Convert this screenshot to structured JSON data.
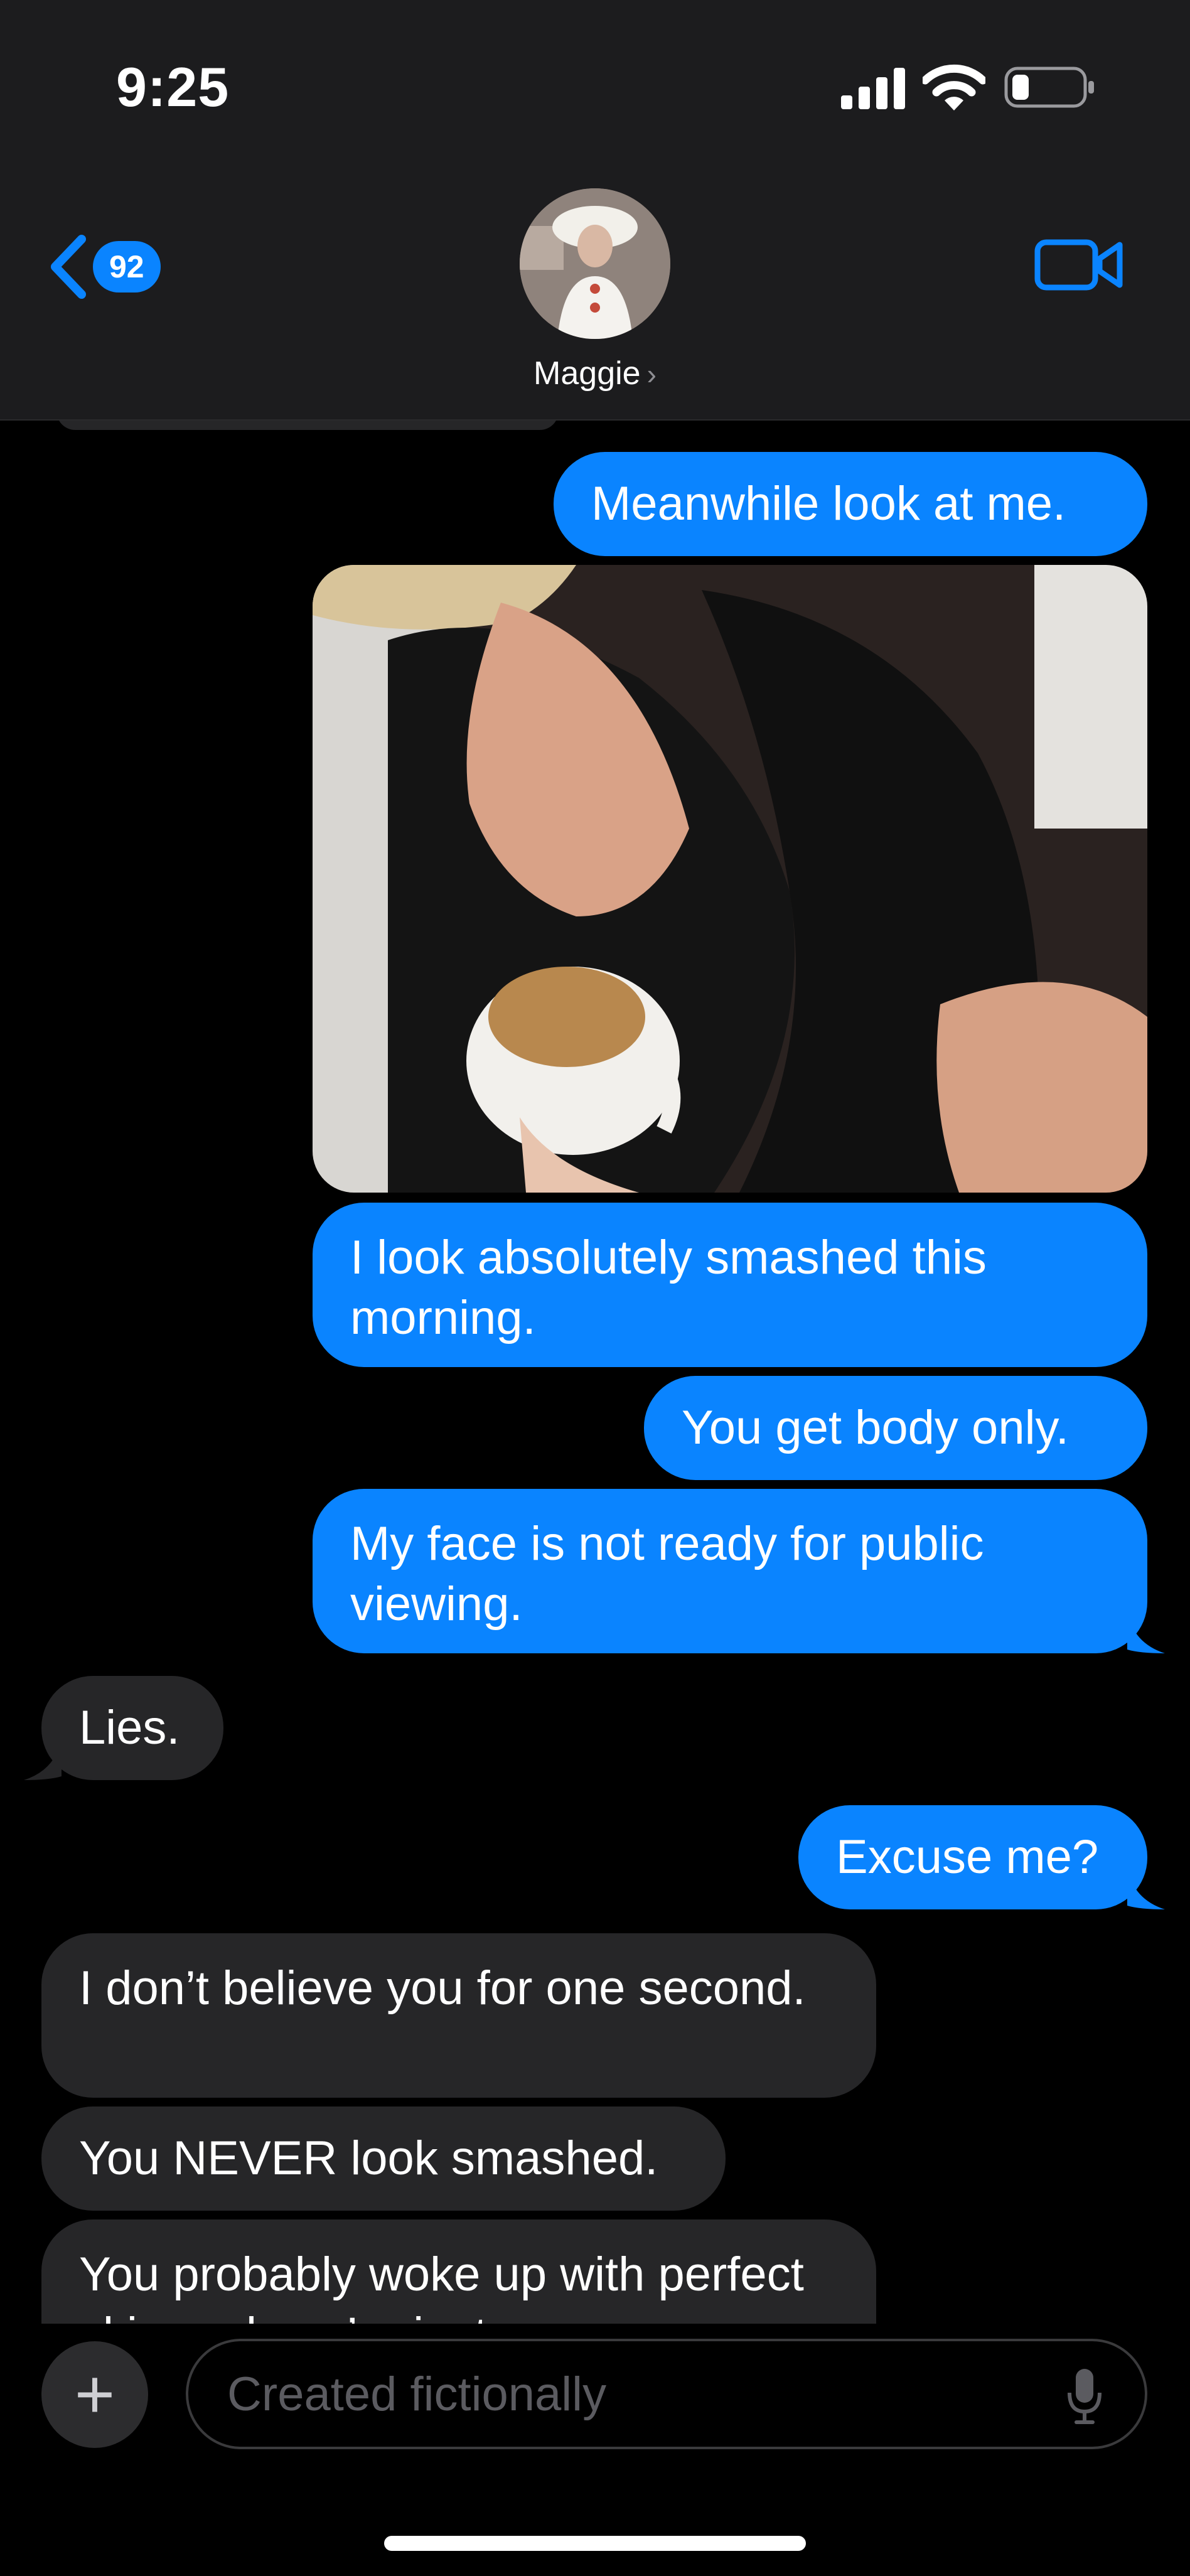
{
  "status_bar": {
    "time": "9:25"
  },
  "header": {
    "back_badge": "92",
    "contact_name": "Maggie",
    "chevron": "›"
  },
  "messages": [
    {
      "side": "sent",
      "text": "Meanwhile look at me."
    },
    {
      "side": "sent",
      "type": "photo"
    },
    {
      "side": "sent",
      "text": "I look absolutely smashed this morning."
    },
    {
      "side": "sent",
      "text": "You get body only."
    },
    {
      "side": "sent",
      "text": "My face is not ready for public viewing."
    },
    {
      "side": "received",
      "text": "Lies."
    },
    {
      "side": "sent",
      "text": "Excuse me?"
    },
    {
      "side": "received",
      "text": "I don’t believe you for one second."
    },
    {
      "side": "received",
      "text": "You NEVER look smashed."
    },
    {
      "side": "received",
      "text": "You probably woke up with perfect skin and you’re just"
    }
  ],
  "composer": {
    "placeholder": "Created fictionally",
    "plus": "+"
  },
  "colors": {
    "sent_bubble": "#0a84ff",
    "received_bubble": "#262628",
    "background": "#000000",
    "header": "#1c1c1e"
  },
  "icons": [
    "signal-icon",
    "wifi-icon",
    "battery-icon",
    "back-chevron-icon",
    "video-camera-icon",
    "microphone-icon",
    "plus-icon"
  ]
}
